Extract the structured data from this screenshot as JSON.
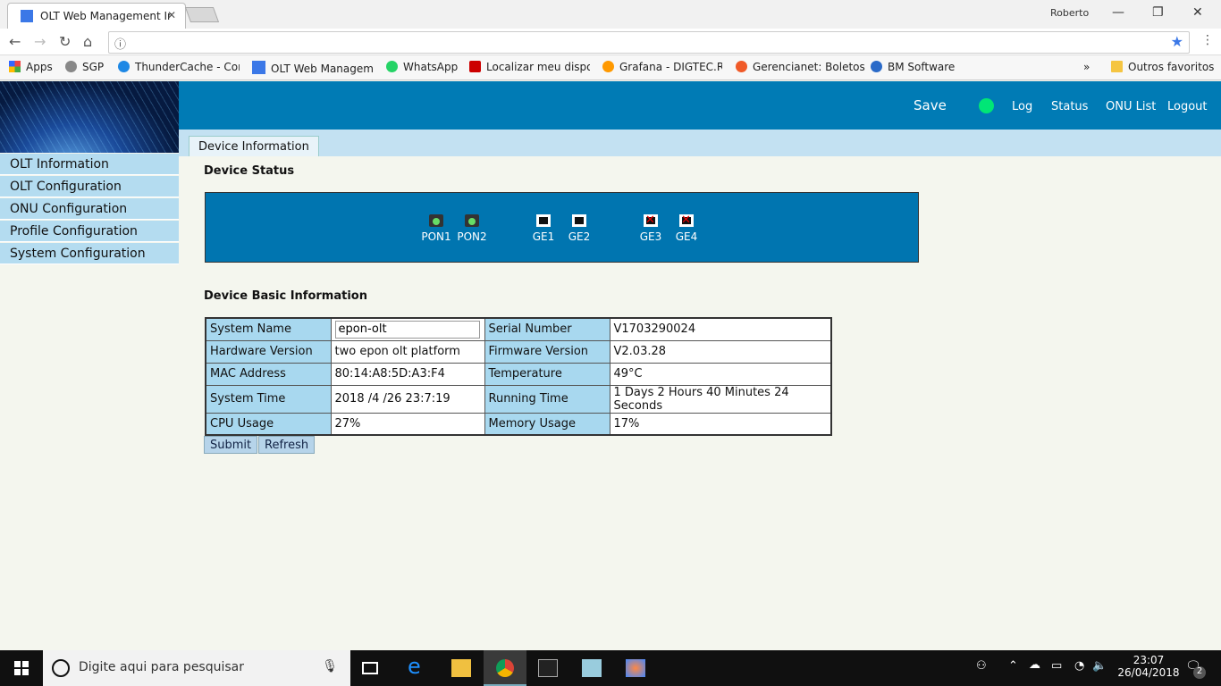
{
  "browser": {
    "tab_title": "OLT Web Management Ir",
    "profile": "Roberto",
    "address": "",
    "bookmarks": [
      {
        "label": "Apps",
        "color": "#e44"
      },
      {
        "label": "SGP",
        "color": "#888"
      },
      {
        "label": "ThunderCache - Cont",
        "color": "#1e88e5"
      },
      {
        "label": "OLT Web Manageme",
        "color": "#3b78e7"
      },
      {
        "label": "WhatsApp",
        "color": "#25d366"
      },
      {
        "label": "Localizar meu disposi",
        "color": "#c00"
      },
      {
        "label": "Grafana - DIGTEC.RN",
        "color": "#f90"
      },
      {
        "label": "Gerencianet: Boletos",
        "color": "#f05a28"
      },
      {
        "label": "BM Software",
        "color": "#2a6ac8"
      }
    ],
    "more": "»",
    "other_bookmarks": "Outros favoritos"
  },
  "sidebar": {
    "items": [
      "OLT Information",
      "OLT Configuration",
      "ONU Configuration",
      "Profile Configuration",
      "System Configuration"
    ]
  },
  "header": {
    "save": "Save",
    "log": "Log",
    "status": "Status",
    "onu_list": "ONU List",
    "logout": "Logout",
    "status_color": "#00e676"
  },
  "tab": "Device Information",
  "device_status": {
    "title": "Device Status",
    "ports": [
      {
        "name": "PON1",
        "type": "pon",
        "up": true
      },
      {
        "name": "PON2",
        "type": "pon",
        "up": true
      },
      {
        "name": "GE1",
        "type": "ge",
        "up": true
      },
      {
        "name": "GE2",
        "type": "ge",
        "up": true
      },
      {
        "name": "GE3",
        "type": "ge",
        "up": false
      },
      {
        "name": "GE4",
        "type": "ge",
        "up": false
      }
    ]
  },
  "basic": {
    "title": "Device Basic Information",
    "rows": [
      [
        "System Name",
        "epon-olt",
        "Serial Number",
        "V1703290024"
      ],
      [
        "Hardware Version",
        "two epon olt platform",
        "Firmware Version",
        "V2.03.28"
      ],
      [
        "MAC Address",
        "80:14:A8:5D:A3:F4",
        "Temperature",
        "49°C"
      ],
      [
        "System Time",
        "2018 /4 /26 23:7:19",
        "Running Time",
        "1 Days 2 Hours 40 Minutes 24 Seconds"
      ],
      [
        "CPU Usage",
        "27%",
        "Memory Usage",
        "17%"
      ]
    ],
    "submit": "Submit",
    "refresh": "Refresh"
  },
  "taskbar": {
    "search_placeholder": "Digite aqui para pesquisar",
    "time": "23:07",
    "date": "26/04/2018",
    "notifications": "2"
  }
}
